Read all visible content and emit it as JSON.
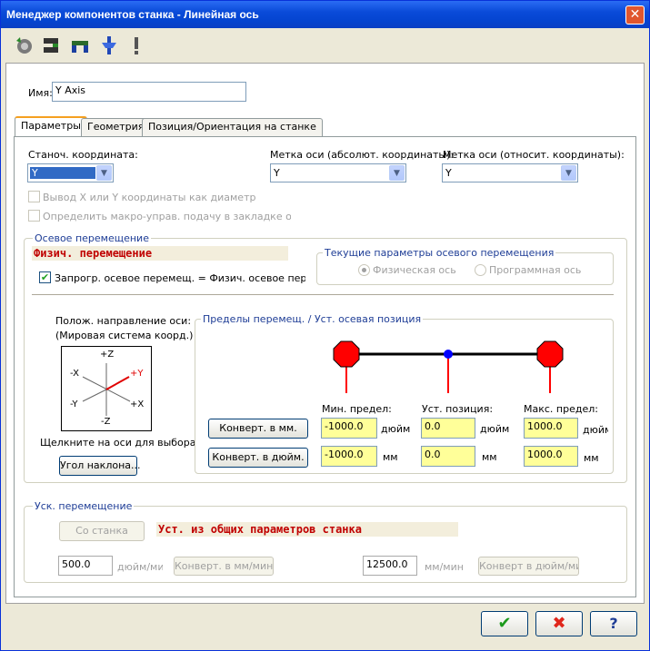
{
  "window": {
    "title": "Менеджер компонентов станка - Линейная ось",
    "close": "✕",
    "toolbar_icons": [
      "rotary-axis-icon",
      "linear-axis-icon",
      "spindle-icon",
      "tool-icon",
      "warning-icon"
    ]
  },
  "name": {
    "label": "Имя:",
    "value": "Y Axis"
  },
  "tabs": [
    {
      "label": "Параметры",
      "active": true
    },
    {
      "label": "Геометрия",
      "active": false
    },
    {
      "label": "Позиция/Ориентация на станке",
      "active": false
    }
  ],
  "params": {
    "machine_coord_label": "Станоч. координата:",
    "machine_coord_value": "Y",
    "abs_label_label": "Метка оси (абсолют. координаты):",
    "abs_label_value": "Y",
    "rel_label_label": "Метка оси (относит. координаты):",
    "rel_label_value": "Y",
    "check_diameter": "Вывод X или Y координаты как диаметр",
    "check_macro": "Определить макро-управ. подачу в закладке осевых п"
  },
  "axis_motion": {
    "group_label": "Осевое перемещение",
    "physical_header": "Физич. перемещение",
    "programmed_check": "Запрогр. осевое перемещ. = Физич. осевое перемещ.",
    "current_params_label": "Текущие параметры осевого перемещения",
    "radio_physical": "Физическая ось",
    "radio_programmed": "Программная ось",
    "direction_label_1": "Полож. направление оси:",
    "direction_label_2": "(Мировая система коорд.)",
    "triad": {
      "z_pos": "+Z",
      "z_neg": "-Z",
      "x_neg": "-X",
      "x_pos": "+X",
      "y_pos": "+Y",
      "y_neg": "-Y"
    },
    "click_hint": "Щелкните на оси для выбора",
    "tilt_button": "Угол наклона...",
    "limits_label": "Пределы перемещ. / Уст. осевая позиция",
    "min_label": "Мин. предел:",
    "home_label": "Уст. позиция:",
    "max_label": "Макс. предел:",
    "convert_mm": "Конверт. в мм.",
    "convert_inch": "Конверт. в дюйм.",
    "min_inch": "-1000.0",
    "home_inch": "0.0",
    "max_inch": "1000.0",
    "min_mm": "-1000.0",
    "home_mm": "0.0",
    "max_mm": "1000.0",
    "unit_inch": "дюйм",
    "unit_mm": "мм"
  },
  "rapid": {
    "group_label": "Уск. перемещение",
    "from_machine": "Со станка",
    "header": "Уст. из общих параметров станка",
    "inch_value": "500.0",
    "inch_unit": "дюйм/мин",
    "convert_mm_min": "Конверт. в мм/мин",
    "mm_value": "12500.0",
    "mm_unit": "мм/мин",
    "convert_inch_min": "Конверт в дюйм/мин"
  },
  "dialog": {
    "ok": "✔",
    "cancel": "✖",
    "help": "?"
  },
  "colors": {
    "limit_stop": "#ff0000",
    "home_marker": "#0000ff",
    "input_highlight": "#ffff99",
    "title_bar": "#0a4bd9"
  }
}
